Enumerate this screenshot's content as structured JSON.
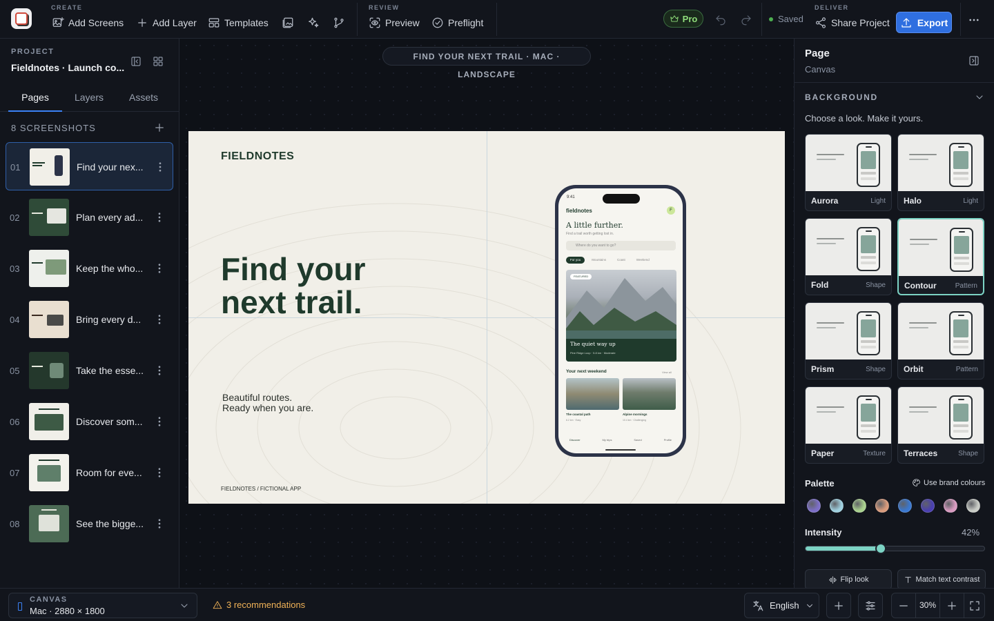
{
  "topbar": {
    "create_label": "CREATE",
    "add_screens": "Add Screens",
    "add_layer": "Add Layer",
    "templates": "Templates",
    "review_label": "REVIEW",
    "preview": "Preview",
    "preflight": "Preflight",
    "pro_badge": "Pro",
    "saved": "Saved",
    "deliver_label": "DELIVER",
    "share_project": "Share Project",
    "export": "Export"
  },
  "sidebar": {
    "project_label": "PROJECT",
    "project_name": "Fieldnotes · Launch co...",
    "tabs": [
      {
        "label": "Pages",
        "active": true
      },
      {
        "label": "Layers",
        "active": false
      },
      {
        "label": "Assets",
        "active": false
      }
    ],
    "screenshots_header": "8 SCREENSHOTS",
    "screenshots": [
      {
        "num": "01",
        "label": "Find your nex...",
        "selected": true
      },
      {
        "num": "02",
        "label": "Plan every ad...",
        "selected": false
      },
      {
        "num": "03",
        "label": "Keep the who...",
        "selected": false
      },
      {
        "num": "04",
        "label": "Bring every d...",
        "selected": false
      },
      {
        "num": "05",
        "label": "Take the esse...",
        "selected": false
      },
      {
        "num": "06",
        "label": "Discover som...",
        "selected": false
      },
      {
        "num": "07",
        "label": "Room for eve...",
        "selected": false
      },
      {
        "num": "08",
        "label": "See the bigge...",
        "selected": false
      }
    ]
  },
  "canvas": {
    "artboard_pill": "FIND YOUR NEXT TRAIL · MAC · LANDSCAPE",
    "artboard": {
      "brand": "FIELDNOTES",
      "headline": "Find your next trail.",
      "subline_1": "Beautiful routes.",
      "subline_2": "Ready when you are.",
      "footer": "FIELDNOTES / FICTIONAL APP"
    },
    "phone": {
      "time": "9:41",
      "brand": "fieldnotes",
      "avatar": "F",
      "title": "A little further.",
      "tagline": "Find a trail worth getting lost in.",
      "search_placeholder": "Where do you want to go?",
      "chips": [
        "For you",
        "Mountains",
        "Coast",
        "Weekend"
      ],
      "hero_badge": "FEATURED",
      "hero_title": "The quiet way up",
      "hero_meta": "Pine Ridge Loop · 5.8 km · Moderate",
      "section": "Your next weekend",
      "view_all": "View all",
      "cards": [
        {
          "title": "The coastal path",
          "meta": "6.2 km · Easy"
        },
        {
          "title": "Alpine mornings",
          "meta": "10.4 km · Challenging"
        }
      ],
      "nav": [
        "Discover",
        "My trips",
        "Saved",
        "Profile"
      ]
    }
  },
  "inspector": {
    "title": "Page",
    "subtitle": "Canvas",
    "background_section": "BACKGROUND",
    "hint": "Choose a look. Make it yours.",
    "looks": [
      {
        "name": "Aurora",
        "type": "Light",
        "selected": false
      },
      {
        "name": "Halo",
        "type": "Light",
        "selected": false
      },
      {
        "name": "Fold",
        "type": "Shape",
        "selected": false
      },
      {
        "name": "Contour",
        "type": "Pattern",
        "selected": true
      },
      {
        "name": "Prism",
        "type": "Shape",
        "selected": false
      },
      {
        "name": "Orbit",
        "type": "Pattern",
        "selected": false
      },
      {
        "name": "Paper",
        "type": "Texture",
        "selected": false
      },
      {
        "name": "Terraces",
        "type": "Shape",
        "selected": false
      }
    ],
    "palette_label": "Palette",
    "use_brand_colours": "Use brand colours",
    "palette": [
      "#7d6fc8",
      "#9fd0df",
      "#a9d18e",
      "#d99b7c",
      "#3a78d0",
      "#4a3fb0",
      "#d89ac0",
      "#c9ccc6"
    ],
    "intensity_label": "Intensity",
    "intensity_value": "42%",
    "intensity": 0.42,
    "flip_look": "Flip look",
    "match_text_contrast": "Match text contrast"
  },
  "bottombar": {
    "canvas_label": "CANVAS",
    "canvas_value": "Mac · 2880 × 1800",
    "recommendations": "3 recommendations",
    "language": "English",
    "zoom": "30%"
  },
  "colors": {
    "accent": "#2f6fe0",
    "teal": "#7cd3c4",
    "warning": "#f0b257",
    "pro": "#8fdc7a",
    "brand_green": "#1f3a2c"
  }
}
